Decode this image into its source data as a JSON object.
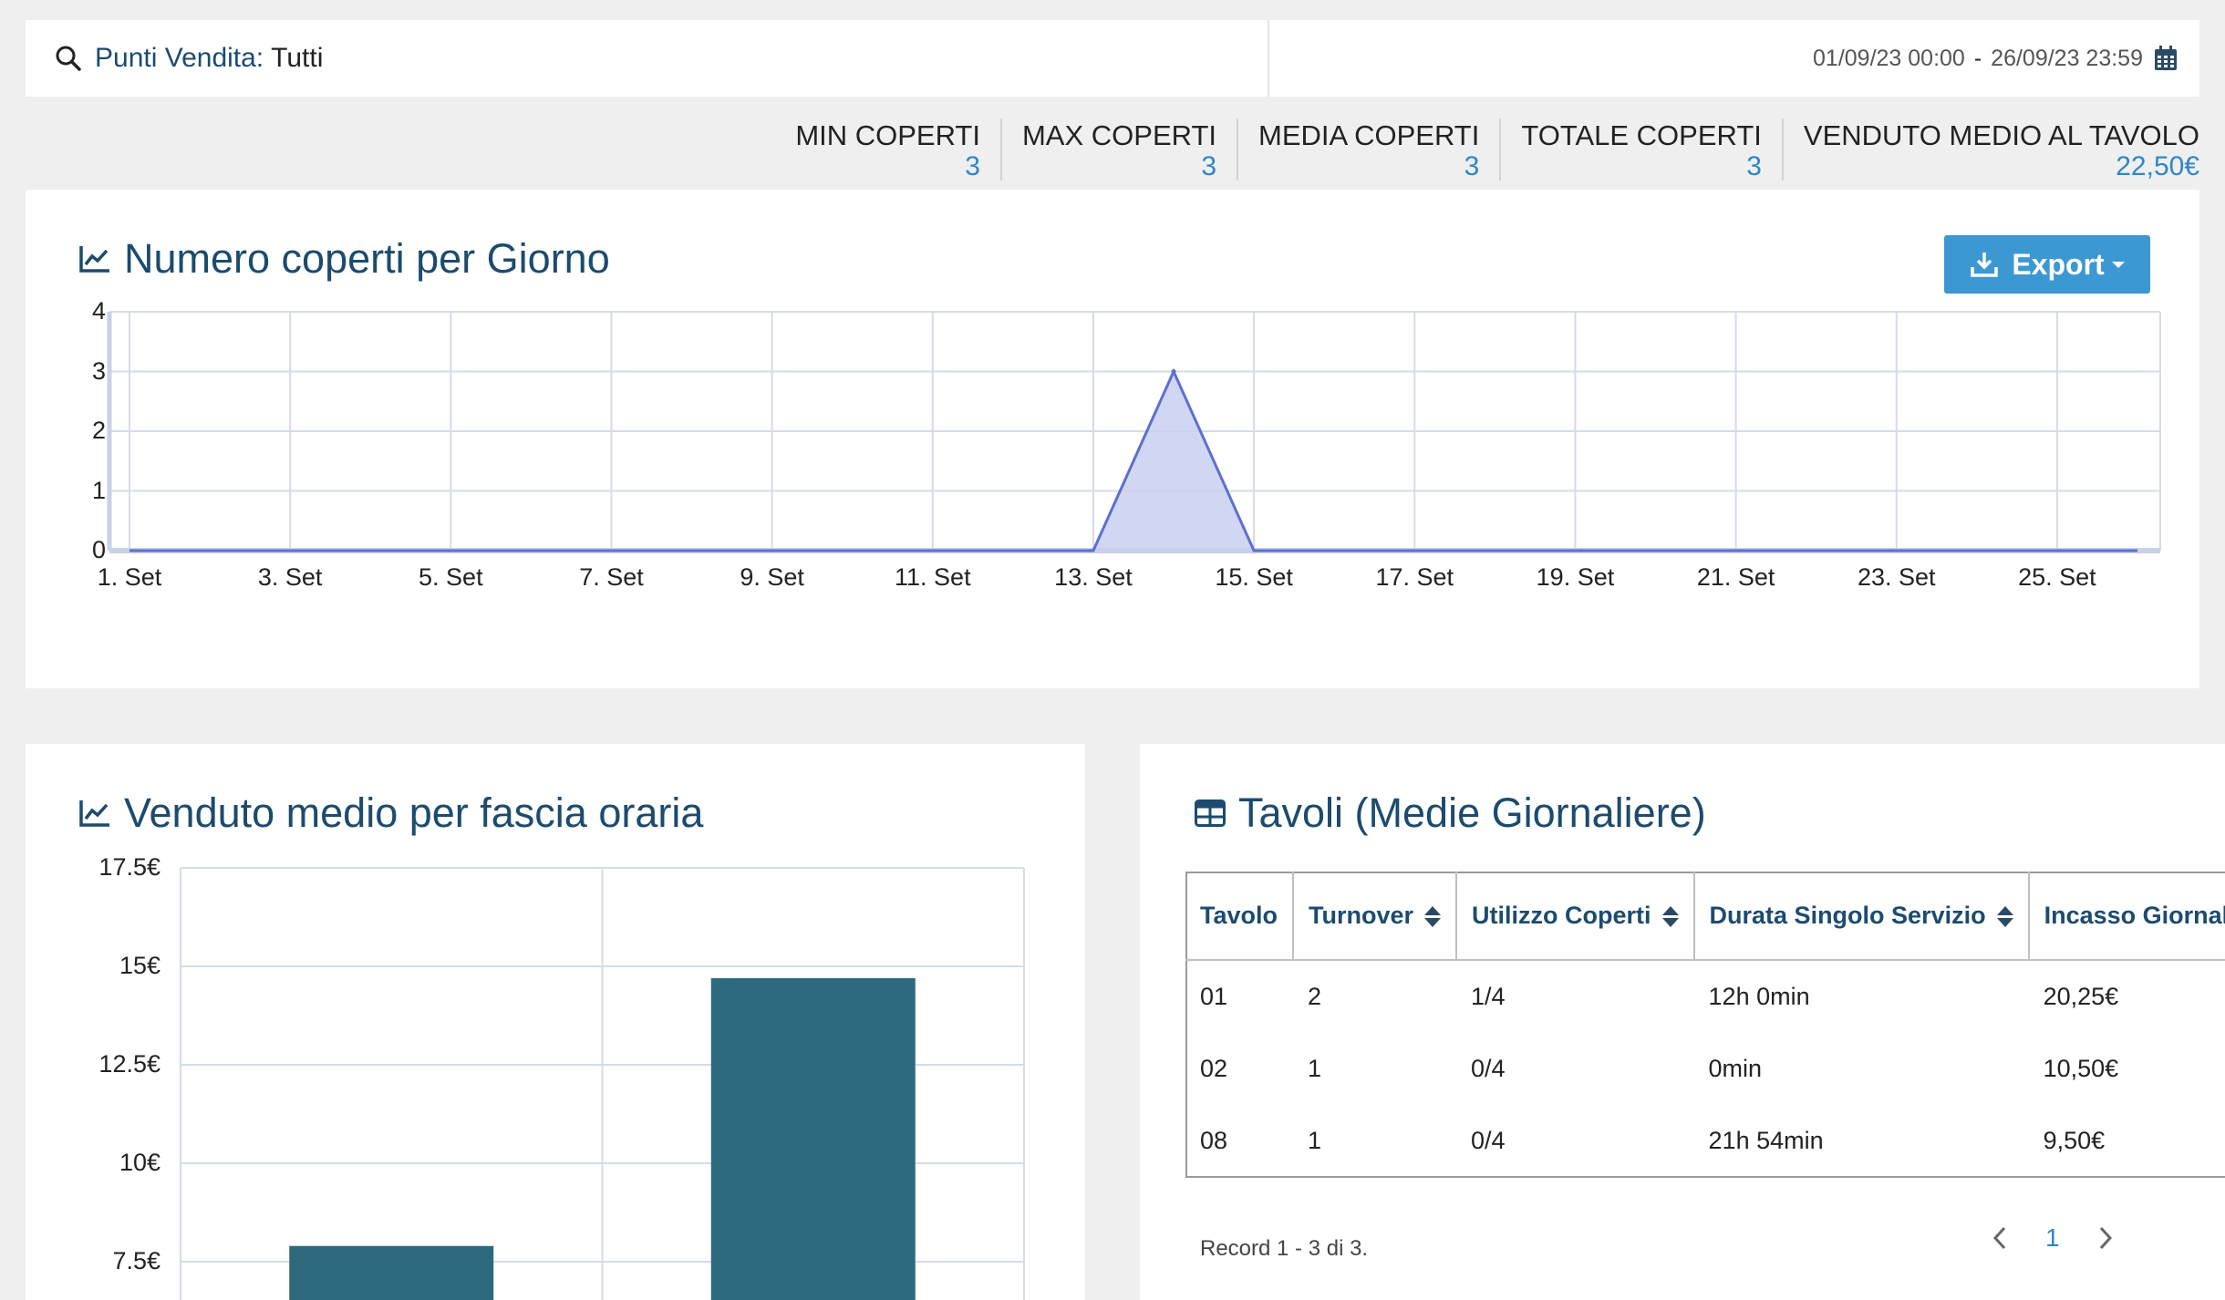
{
  "filter": {
    "label": "Punti Vendita:",
    "value": "Tutti"
  },
  "date_range": {
    "from": "01/09/23 00:00",
    "separator": "-",
    "to": "26/09/23 23:59"
  },
  "stats": [
    {
      "label": "MIN COPERTI",
      "value": "3"
    },
    {
      "label": "MAX COPERTI",
      "value": "3"
    },
    {
      "label": "MEDIA COPERTI",
      "value": "3"
    },
    {
      "label": "TOTALE COPERTI",
      "value": "3"
    },
    {
      "label": "VENDUTO MEDIO AL TAVOLO",
      "value": "22,50€"
    }
  ],
  "chart1": {
    "title": "Numero coperti per Giorno",
    "export_label": "Export",
    "color_fill": "#c9cff0",
    "color_line": "#5d6fd0"
  },
  "chart2": {
    "title": "Venduto medio per fascia oraria",
    "bar_color": "#2e6a7e"
  },
  "table": {
    "title": "Tavoli (Medie Giornaliere)",
    "headers": [
      "Tavolo",
      "Turnover",
      "Utilizzo Coperti",
      "Durata Singolo Servizio",
      "Incasso Giornaliero"
    ],
    "rows": [
      [
        "01",
        "2",
        "1/4",
        "12h 0min",
        "20,25€"
      ],
      [
        "02",
        "1",
        "0/4",
        "0min",
        "10,50€"
      ],
      [
        "08",
        "1",
        "0/4",
        "21h 54min",
        "9,50€"
      ]
    ],
    "record_info": "Record 1 - 3 di 3.",
    "page": "1"
  },
  "chart_data": [
    {
      "type": "area",
      "title": "Numero coperti per Giorno",
      "x": [
        "1. Set",
        "2. Set",
        "3. Set",
        "4. Set",
        "5. Set",
        "6. Set",
        "7. Set",
        "8. Set",
        "9. Set",
        "10. Set",
        "11. Set",
        "12. Set",
        "13. Set",
        "14. Set",
        "15. Set",
        "16. Set",
        "17. Set",
        "18. Set",
        "19. Set",
        "20. Set",
        "21. Set",
        "22. Set",
        "23. Set",
        "24. Set",
        "25. Set",
        "26. Set"
      ],
      "x_tick_labels": [
        "1. Set",
        "3. Set",
        "5. Set",
        "7. Set",
        "9. Set",
        "11. Set",
        "13. Set",
        "15. Set",
        "17. Set",
        "19. Set",
        "21. Set",
        "23. Set",
        "25. Set"
      ],
      "values": [
        0,
        0,
        0,
        0,
        0,
        0,
        0,
        0,
        0,
        0,
        0,
        0,
        0,
        3,
        0,
        0,
        0,
        0,
        0,
        0,
        0,
        0,
        0,
        0,
        0,
        0
      ],
      "y_ticks": [
        "0",
        "1",
        "2",
        "3",
        "4"
      ],
      "ylim": [
        0,
        4
      ],
      "grid": true
    },
    {
      "type": "bar",
      "title": "Venduto medio per fascia oraria",
      "categories": [
        "",
        ""
      ],
      "values": [
        7.9,
        14.7
      ],
      "y_ticks": [
        "7.5€",
        "10€",
        "12.5€",
        "15€",
        "17.5€"
      ],
      "ylim": [
        5,
        17.5
      ],
      "grid": true
    }
  ]
}
